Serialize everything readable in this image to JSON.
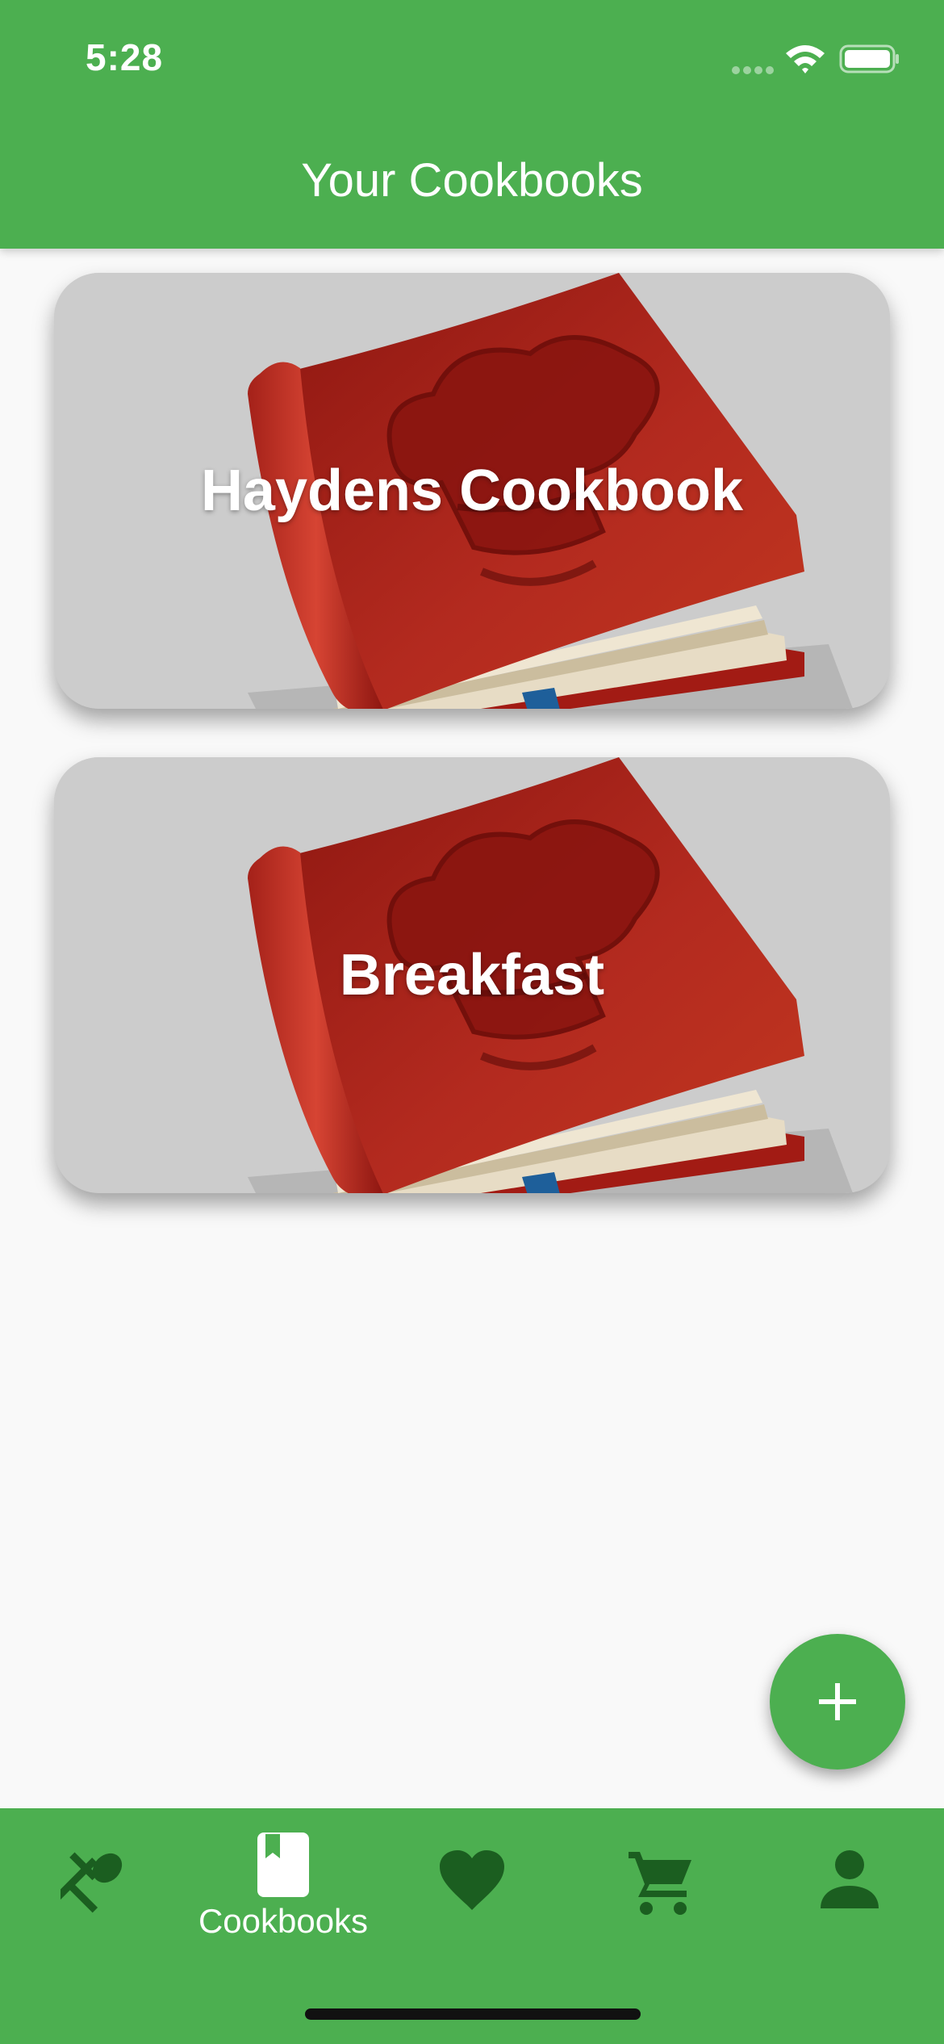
{
  "status_bar": {
    "time": "5:28"
  },
  "header": {
    "title": "Your Cookbooks"
  },
  "cookbooks": [
    {
      "name": "Haydens Cookbook",
      "image": "red-cookbook-chef-hat"
    },
    {
      "name": "Breakfast",
      "image": "red-cookbook-chef-hat"
    }
  ],
  "fab": {
    "icon": "plus-icon"
  },
  "bottom_nav": {
    "active": "Cookbooks",
    "items": [
      {
        "id": "recipes",
        "icon": "fork-spoon-icon",
        "label": ""
      },
      {
        "id": "cookbooks",
        "icon": "bookmark-book-icon",
        "label": "Cookbooks"
      },
      {
        "id": "favorites",
        "icon": "heart-icon",
        "label": ""
      },
      {
        "id": "cart",
        "icon": "cart-icon",
        "label": ""
      },
      {
        "id": "profile",
        "icon": "person-icon",
        "label": ""
      }
    ]
  },
  "colors": {
    "primary": "#4caf50",
    "icon_inactive": "#1b5e20",
    "icon_active": "#ffffff",
    "background": "#f9f9f9",
    "card_background": "#cccccc",
    "book_red": "#b22a1e"
  }
}
